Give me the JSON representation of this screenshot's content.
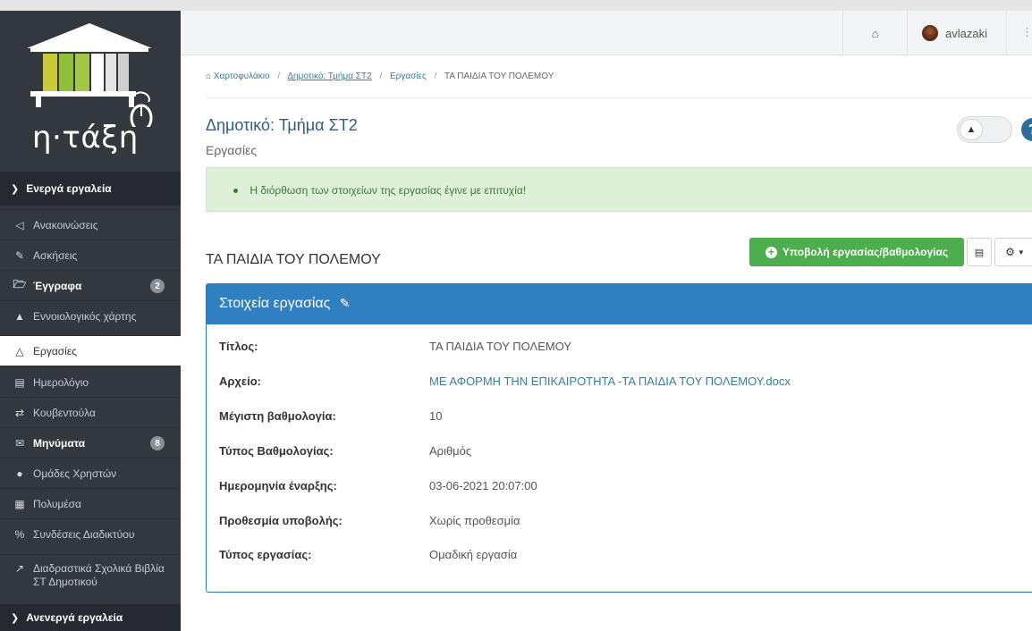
{
  "app": {
    "logo_text": "η·τάξη"
  },
  "sidebar": {
    "active_section": "Ενεργά εργαλεία",
    "items": [
      {
        "label": "Ανακοινώσεις",
        "icon": "bullhorn-icon"
      },
      {
        "label": "Ασκήσεις",
        "icon": "edit-icon"
      },
      {
        "label": "Έγγραφα",
        "icon": "folder-icon",
        "badge": "2"
      },
      {
        "label": "Εννοιολογικός χάρτης",
        "icon": "sitemap-icon"
      },
      {
        "label": "Εργασίες",
        "icon": "flask-icon"
      },
      {
        "label": "Ημερολόγιο",
        "icon": "calendar-icon"
      },
      {
        "label": "Κουβεντούλα",
        "icon": "exchange-icon"
      },
      {
        "label": "Μηνύματα",
        "icon": "envelope-icon",
        "badge": "8"
      },
      {
        "label": "Ομάδες Χρηστών",
        "icon": "users-icon"
      },
      {
        "label": "Πολυμέσα",
        "icon": "film-icon"
      },
      {
        "label": "Συνδέσεις Διαδικτύου",
        "icon": "link-icon"
      },
      {
        "label": "Διαδραστικά Σχολικά Βιβλία ΣΤ Δημοτικού",
        "icon": "external-link-icon"
      }
    ],
    "inactive_section": "Ανενεργά εργαλεία"
  },
  "header": {
    "username": "avlazaki"
  },
  "breadcrumb": {
    "items": [
      "Χαρτοφυλάκιο",
      "Δημοτικό: Τμήμα ΣΤ2",
      "Εργασίες"
    ],
    "current": "ΤΑ ΠΑΙΔΙΑ ΤΟΥ ΠΟΛΕΜΟΥ"
  },
  "page": {
    "title": "Δημοτικό: Τμήμα ΣΤ2",
    "subtitle": "Εργασίες"
  },
  "alert": {
    "message": "Η διόρθωση των στοιχείων της εργασίας έγινε με επιτυχία!"
  },
  "assignment": {
    "title": "ΤΑ ΠΑΙΔΙΑ ΤΟΥ ΠΟΛΕΜΟΥ",
    "submit_label": "Υποβολή εργασίας/βαθμολογίας",
    "panel_title": "Στοιχεία εργασίας",
    "fields": [
      {
        "label": "Τίτλος:",
        "value": "ΤΑ ΠΑΙΔΙΑ ΤΟΥ ΠΟΛΕΜΟΥ"
      },
      {
        "label": "Αρχείο:",
        "value": "ΜΕ ΑΦΟΡΜΗ ΤΗΝ ΕΠΙΚΑΙΡΟΤΗΤΑ -ΤΑ ΠΑΙΔΙΑ ΤΟΥ ΠΟΛΕΜΟΥ.docx"
      },
      {
        "label": "Μέγιστη βαθμολογία:",
        "value": "10"
      },
      {
        "label": "Τύπος Βαθμολογίας:",
        "value": "Αριθμός"
      },
      {
        "label": "Ημερομηνία έναρξης:",
        "value": "03-06-2021 20:07:00"
      },
      {
        "label": "Προθεσμία υποβολής:",
        "value": "Χωρίς προθεσμία"
      },
      {
        "label": "Τύπος εργασίας:",
        "value": "Ομαδική εργασία"
      }
    ]
  },
  "colors": {
    "sidebar": "#33373e",
    "accent": "#2f7fc1",
    "success": "#4cae4c",
    "link": "#3c7d99"
  }
}
